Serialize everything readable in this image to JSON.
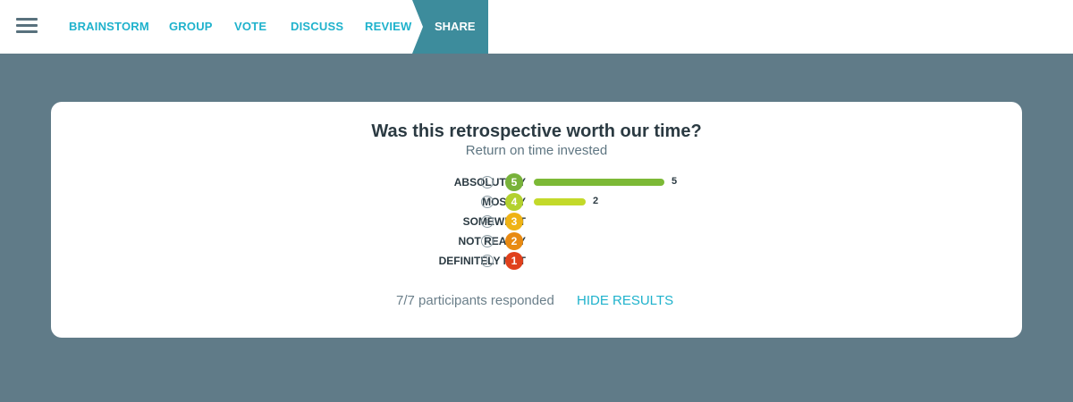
{
  "nav": {
    "items": [
      "BRAINSTORM",
      "GROUP",
      "VOTE",
      "DISCUSS",
      "REVIEW"
    ],
    "active": "SHARE",
    "colors": {
      "link": "#1fb2cc",
      "active_bg": "#3d8c9c"
    }
  },
  "card": {
    "title": "Was this retrospective worth our time?",
    "subtitle": "Return on time invested",
    "rows": [
      {
        "label": "ABSOLUTELY",
        "score": "5",
        "count": 5,
        "color": "#78b23a",
        "bar_color": "#7cb936"
      },
      {
        "label": "MOSTLY",
        "score": "4",
        "count": 2,
        "color": "#b3d12e",
        "bar_color": "#c3d92a"
      },
      {
        "label": "SOMEWHAT",
        "score": "3",
        "count": 0,
        "color": "#efb315",
        "bar_color": "#efb315"
      },
      {
        "label": "NOT REALLY",
        "score": "2",
        "count": 0,
        "color": "#e88a12",
        "bar_color": "#e88a12"
      },
      {
        "label": "DEFINITELY NOT",
        "score": "1",
        "count": 0,
        "color": "#e0401c",
        "bar_color": "#e0401c"
      }
    ],
    "max_count": 5,
    "participants": "7/7 participants responded",
    "hide_label": "HIDE RESULTS"
  }
}
